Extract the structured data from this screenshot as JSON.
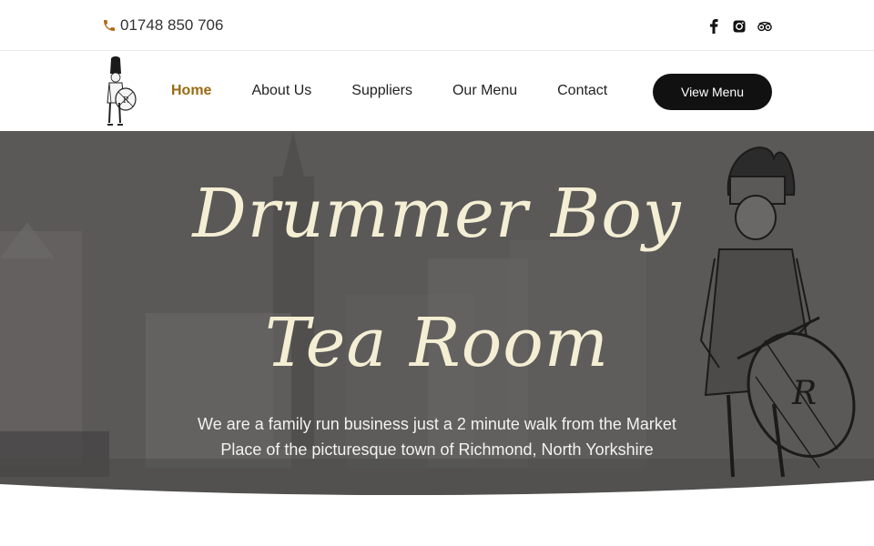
{
  "topbar": {
    "phone": "01748 850 706",
    "icons": [
      "phone-icon",
      "facebook-icon",
      "instagram-icon",
      "tripadvisor-icon"
    ]
  },
  "nav": {
    "items": [
      {
        "label": "Home",
        "active": true
      },
      {
        "label": "About Us"
      },
      {
        "label": "Suppliers"
      },
      {
        "label": "Our Menu"
      },
      {
        "label": "Contact"
      }
    ],
    "cta": "View Menu",
    "active_color": "#9a6a13"
  },
  "hero": {
    "title_line1": "Drummer Boy",
    "title_line2": "Tea Room",
    "subtitle_line1": "We are a family run business just a 2 minute walk from the Market",
    "subtitle_line2": "Place of the picturesque town of Richmond, North Yorkshire",
    "title_color": "#f4eed4",
    "background_color": "#5a5958"
  }
}
